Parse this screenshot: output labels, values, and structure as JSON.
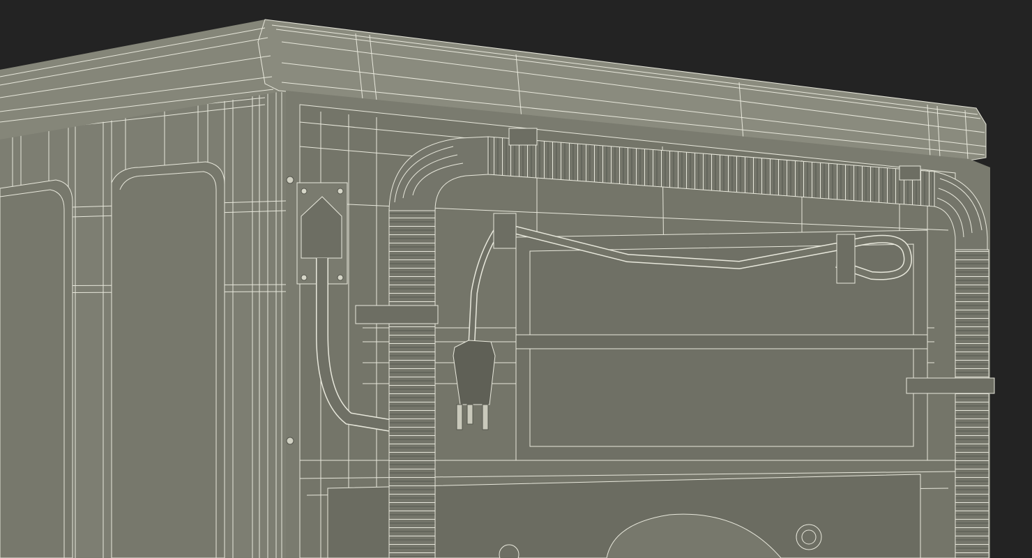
{
  "scene": {
    "subject": "appliance-rear-wireframe",
    "colors": {
      "background": "#232323",
      "surface": "#7d7e72",
      "surface_dark": "#66675d",
      "surface_light": "#8f9084",
      "wire": "#e8e8dc",
      "hose": "#74756a",
      "shadow": "#3f403a"
    },
    "icons": [
      "power-plug-icon",
      "hose-icon",
      "cable-icon",
      "clip-icon"
    ]
  }
}
